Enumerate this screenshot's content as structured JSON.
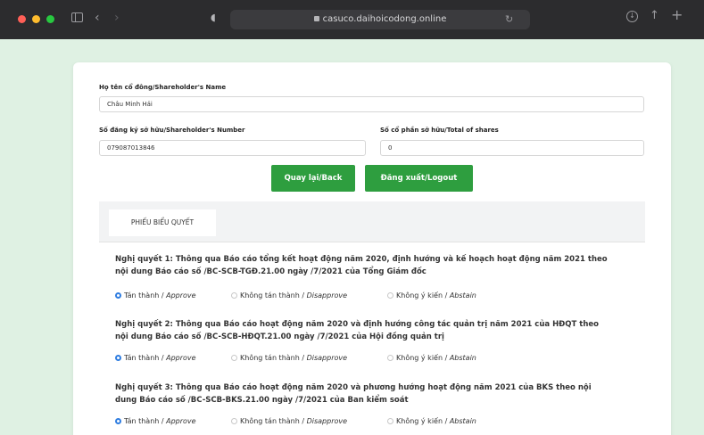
{
  "browser": {
    "url": "casuco.daihoicodong.online",
    "icons": [
      "sidebar-icon",
      "back-icon",
      "forward-icon",
      "shield-icon",
      "lock-icon",
      "reload-icon",
      "download-icon",
      "share-icon",
      "plus-icon"
    ]
  },
  "form": {
    "name_label": "Họ tên cổ đông/Shareholder's Name",
    "name_value": "Châu Minh Hải",
    "number_label": "Số đăng ký sở hữu/Shareholder's Number",
    "number_value": "079087013846",
    "shares_label": "Số cổ phần sở hữu/Total of shares",
    "shares_value": "0"
  },
  "buttons": {
    "back": "Quay lại/Back",
    "logout": "Đăng xuất/Logout"
  },
  "colors": {
    "accent": "#2e9e3f",
    "radio_selected": "#2f7de0"
  },
  "ballot": {
    "tab_label": "PHIẾU BIỂU QUYẾT",
    "resolutions": [
      {
        "line1": "Nghị quyết 1: Thông qua Báo cáo tổng kết hoạt động năm 2020, định hướng và kế hoạch hoạt động năm 2021 theo",
        "line2": "nội dung Báo cáo số /BC-SCB-TGĐ.21.00 ngày /7/2021 của Tổng Giám đốc",
        "selected": "approve"
      },
      {
        "line1": "Nghị quyết 2: Thông qua Báo cáo hoạt động năm 2020 và định hướng công tác quản trị năm 2021 của HĐQT theo",
        "line2": "nội dung Báo cáo số /BC-SCB-HĐQT.21.00 ngày /7/2021 của Hội đồng quản trị",
        "selected": "approve"
      },
      {
        "line1": "Nghị quyết 3: Thông qua Báo cáo hoạt động năm 2020 và phương hướng hoạt động năm 2021 của BKS theo nội",
        "line2": "dung Báo cáo số /BC-SCB-BKS.21.00 ngày /7/2021 của Ban kiểm soát",
        "selected": "approve"
      }
    ],
    "options": {
      "approve_vi": "Tán thành / ",
      "approve_en": "Approve",
      "disapprove_vi": "Không tán thành / ",
      "disapprove_en": "Disapprove",
      "abstain_vi": "Không ý kiến / ",
      "abstain_en": "Abstain"
    }
  }
}
